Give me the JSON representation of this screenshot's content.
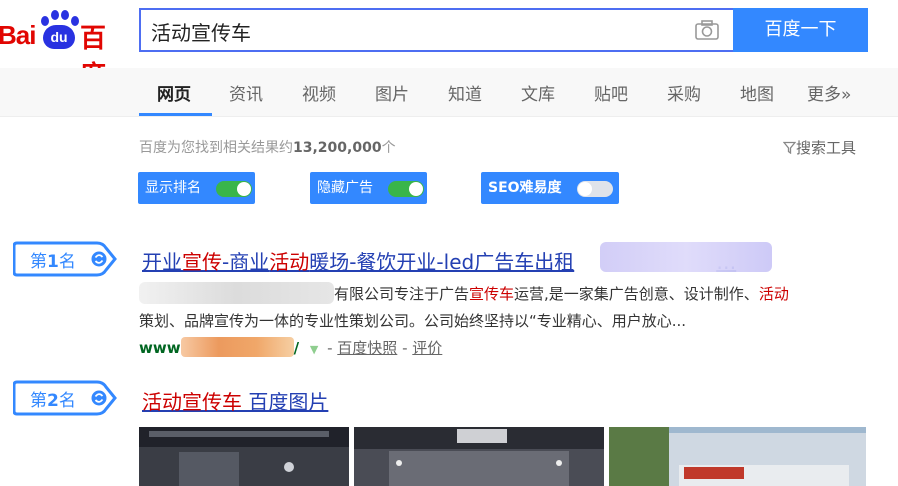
{
  "logo": {
    "bai": "Bai",
    "du": "du",
    "zh": "百度"
  },
  "search": {
    "query": "活动宣传车",
    "button_label": "百度一下"
  },
  "tabs": [
    "网页",
    "资讯",
    "视频",
    "图片",
    "知道",
    "文库",
    "贴吧",
    "采购",
    "地图",
    "更多»"
  ],
  "result_count": {
    "prefix": "百度为您找到相关结果约",
    "number": "13,200,000",
    "suffix": "个"
  },
  "tools_label": "搜索工具",
  "toggles": [
    {
      "label": "显示排名",
      "on": true
    },
    {
      "label": "隐藏广告",
      "on": true
    },
    {
      "label": "SEO难易度",
      "on": false
    }
  ],
  "colors": {
    "accent": "#3388ff",
    "toggle_on": "#39b54a",
    "title_link": "#2440b3",
    "highlight": "#c00000",
    "url_green": "#006621"
  },
  "results": [
    {
      "rank_prefix": "第",
      "rank_num": "1",
      "rank_suffix": "名",
      "title_parts": [
        "开业",
        "宣传",
        "-商业",
        "活动",
        "暖场-餐饮开业-led广告车出租",
        "…"
      ],
      "snippet1_parts": [
        "有限公司专注于广告",
        "宣传车",
        "运营,是一家集广告创意、设计制作、",
        "活动"
      ],
      "snippet2": "策划、品牌宣传为一体的专业性策划公司。公司始终坚持以“专业精心、用户放心...",
      "url_prefix": "www",
      "url_suffix": "/",
      "snapshot_label": "百度快照",
      "review_label": "评价"
    },
    {
      "rank_prefix": "第",
      "rank_num": "2",
      "rank_suffix": "名",
      "title_parts": [
        "活动宣传车",
        " 百度图片"
      ]
    }
  ]
}
